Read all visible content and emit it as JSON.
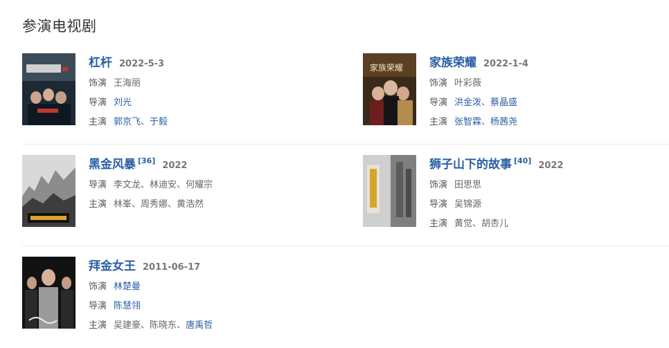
{
  "section_title": "参演电视剧",
  "shows": [
    {
      "title": "杠杆",
      "ref": "",
      "date": "2022-5-3",
      "fields": [
        {
          "label": "饰演",
          "people": [
            {
              "name": "王海丽",
              "link": false
            }
          ]
        },
        {
          "label": "导演",
          "people": [
            {
              "name": "刘光",
              "link": true
            }
          ]
        },
        {
          "label": "主演",
          "people": [
            {
              "name": "郭京飞",
              "link": true
            },
            {
              "name": "于毅",
              "link": true
            }
          ]
        }
      ]
    },
    {
      "title": "家族荣耀",
      "ref": "",
      "date": "2022-1-4",
      "poster_text": "家族荣耀",
      "fields": [
        {
          "label": "饰演",
          "people": [
            {
              "name": "叶彩薇",
              "link": false
            }
          ]
        },
        {
          "label": "导演",
          "people": [
            {
              "name": "洪金泼",
              "link": true
            },
            {
              "name": "蔡晶盛",
              "link": true
            }
          ]
        },
        {
          "label": "主演",
          "people": [
            {
              "name": "张智霖",
              "link": true
            },
            {
              "name": "杨茜尧",
              "link": true
            }
          ]
        }
      ]
    },
    {
      "title": "黑金风暴",
      "ref": "[36]",
      "date": "2022",
      "fields": [
        {
          "label": "导演",
          "people": [
            {
              "name": "李文龙",
              "link": false
            },
            {
              "name": "林迪安",
              "link": false
            },
            {
              "name": "何耀宗",
              "link": false
            }
          ]
        },
        {
          "label": "主演",
          "people": [
            {
              "name": "林峯",
              "link": false
            },
            {
              "name": "周秀娜",
              "link": false
            },
            {
              "name": "黄浩然",
              "link": false
            }
          ]
        }
      ]
    },
    {
      "title": "狮子山下的故事",
      "ref": "[40]",
      "date": "2022",
      "fields": [
        {
          "label": "饰演",
          "people": [
            {
              "name": "田思思",
              "link": false
            }
          ]
        },
        {
          "label": "导演",
          "people": [
            {
              "name": "吴锦源",
              "link": false
            }
          ]
        },
        {
          "label": "主演",
          "people": [
            {
              "name": "黄觉",
              "link": false
            },
            {
              "name": "胡杏儿",
              "link": false
            }
          ]
        }
      ]
    },
    {
      "title": "拜金女王",
      "ref": "",
      "date": "2011-06-17",
      "fields": [
        {
          "label": "饰演",
          "people": [
            {
              "name": "林楚曼",
              "link": true
            }
          ]
        },
        {
          "label": "导演",
          "people": [
            {
              "name": "陈慧翎",
              "link": true
            }
          ]
        },
        {
          "label": "主演",
          "people": [
            {
              "name": "吴建豪",
              "link": false
            },
            {
              "name": "陈晓东",
              "link": false
            },
            {
              "name": "唐禹哲",
              "link": true
            }
          ]
        }
      ]
    }
  ],
  "separator": "、",
  "colors": {
    "link": "#2a5fa5",
    "date": "#777777",
    "text": "#666666"
  }
}
